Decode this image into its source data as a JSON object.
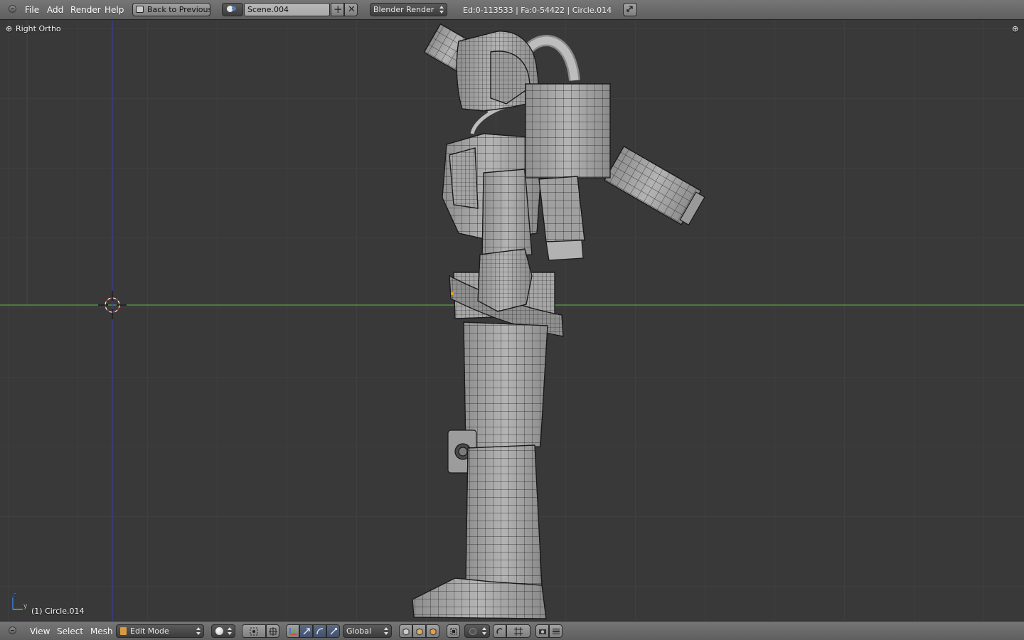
{
  "top_header": {
    "menus": [
      "File",
      "Add",
      "Render",
      "Help"
    ],
    "back_button_label": "Back to Previous",
    "scene_name": "Scene.004",
    "render_engine": "Blender Render",
    "stats": "Ed:0-113533 | Fa:0-54422 | Circle.014"
  },
  "viewport": {
    "view_name": "Right Ortho",
    "axis_labels": {
      "z": "z",
      "y": "y"
    },
    "object_info": "(1) Circle.014",
    "colors": {
      "background": "#393939",
      "grid": "#454545",
      "y_axis": "#5fbf3a",
      "z_axis": "#3a3aa8",
      "mesh_fill": "#a8a8a8",
      "wire": "#1a1a1a"
    }
  },
  "bottom_header": {
    "menus": [
      "View",
      "Select",
      "Mesh"
    ],
    "mode": "Edit Mode",
    "transform_orientation": "Global",
    "icons": [
      "viewport-shading-icon",
      "pivot-icon",
      "manipulator-icon",
      "translate-icon",
      "rotate-icon",
      "scale-icon",
      "vertex-select-icon",
      "edge-select-icon",
      "face-select-icon",
      "occlude-icon",
      "proportional-edit-icon",
      "snap-icon",
      "snap-grid-icon",
      "render-icon",
      "camera-icon"
    ]
  }
}
